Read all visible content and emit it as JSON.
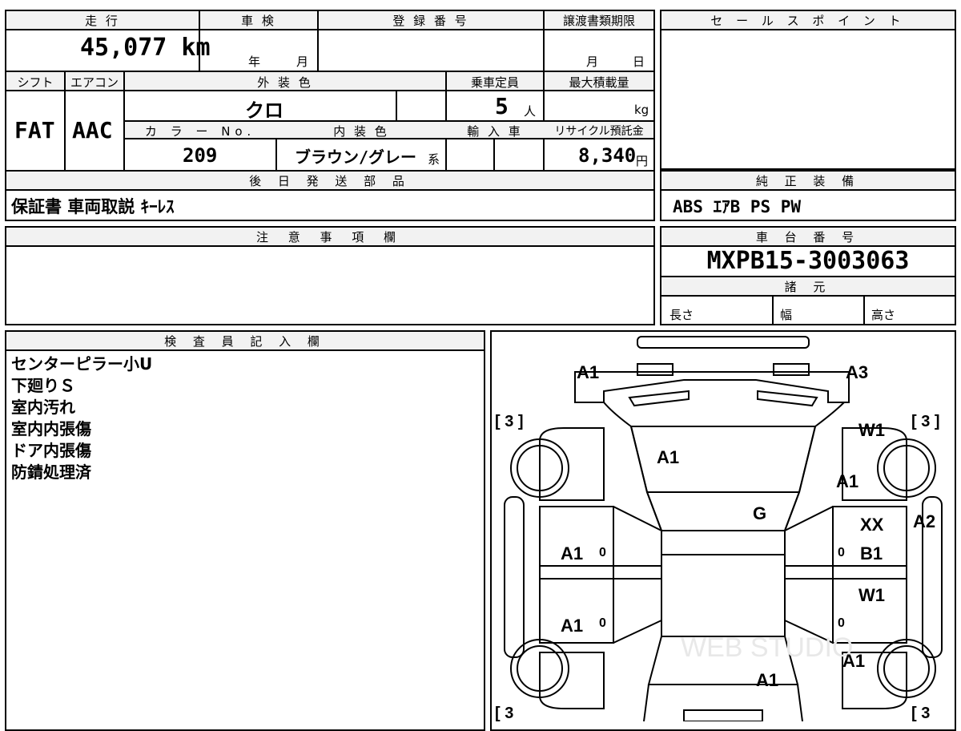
{
  "vehicle_info": {
    "mileage_label": "走 行",
    "mileage": "45,077 km",
    "inspection_label": "車 検",
    "inspection_year": "年",
    "inspection_month": "月",
    "registration_label": "登 録 番 号",
    "transfer_label": "譲渡書類期限",
    "transfer_month": "月",
    "transfer_day": "日",
    "shift_label": "シフト",
    "shift": "FAT",
    "ac_label": "エアコン",
    "ac": "AAC",
    "exterior_color_label": "外 装 色",
    "exterior_color": "クロ",
    "capacity_label": "乗車定員",
    "capacity": "5",
    "capacity_unit": "人",
    "max_load_label": "最大積載量",
    "max_load_unit": "kg",
    "color_no_label": "カ ラ ー No.",
    "color_no": "209",
    "interior_color_label": "内 装 色",
    "interior_color": "ブラウン/グレー",
    "interior_suffix": "系",
    "import_label": "輸 入 車",
    "recycle_label": "リサイクル預託金",
    "recycle_fee": "8,340",
    "recycle_unit": "円"
  },
  "sales_point": {
    "label": "セ ー ル ス ポ イ ン ト"
  },
  "later_parts": {
    "label": "後 日 発 送 部 品",
    "value": "保証書 車両取説 ｷｰﾚｽ"
  },
  "genuine_equipment": {
    "label": "純 正 装 備",
    "value": "ABS ｴｱB PS PW"
  },
  "notes": {
    "label": "注 意 事 項 欄"
  },
  "chassis": {
    "label": "車 台 番 号",
    "value": "MXPB15-3003063"
  },
  "specs": {
    "label": "諸 元",
    "length": "長さ",
    "width": "幅",
    "height": "高さ"
  },
  "inspector": {
    "label": "検 査 員 記 入 欄",
    "lines": [
      "センターピラー小U",
      "下廻りＳ",
      "室内汚れ",
      "室内内張傷",
      "ドア内張傷",
      "防錆処理済"
    ]
  },
  "diagram": {
    "marks": [
      "A1",
      "A3",
      "W1",
      "A1",
      "A1",
      "G",
      "XX",
      "A2",
      "B1",
      "A1",
      "W1",
      "A1",
      "A1",
      "A1"
    ],
    "tire_marks": [
      "[ 3 ]",
      "[ 3 ]",
      "[ 3",
      "[ 3"
    ],
    "zeros": [
      "0",
      "0",
      "0",
      "0"
    ],
    "watermark": "WEB STUDIO"
  }
}
